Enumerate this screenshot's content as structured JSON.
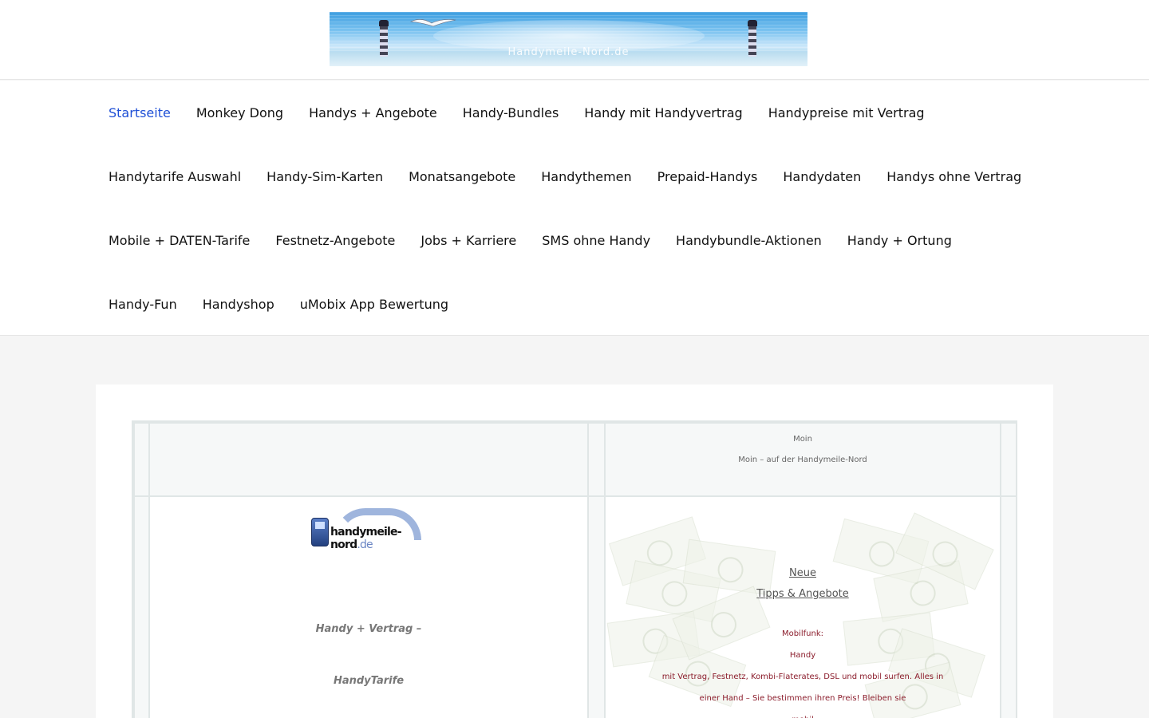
{
  "banner": {
    "text": "Handymeile-Nord.de"
  },
  "nav": {
    "rows": [
      [
        "Startseite",
        "Monkey Dong",
        "Handys + Angebote",
        "Handy-Bundles",
        "Handy mit Handyvertrag",
        "Handypreise mit Vertrag"
      ],
      [
        "Handytarife Auswahl",
        "Handy-Sim-Karten",
        "Monatsangebote",
        "Handythemen",
        "Prepaid-Handys",
        "Handydaten",
        "Handys ohne Vertrag"
      ],
      [
        "Mobile + DATEN-Tarife",
        "Festnetz-Angebote",
        "Jobs + Karriere",
        "SMS ohne Handy",
        "Handybundle-Aktionen",
        "Handy + Ortung"
      ],
      [
        "Handy-Fun",
        "Handyshop",
        "uMobix App Bewertung"
      ]
    ],
    "active": "Startseite",
    "active_color": "#1e4fd6"
  },
  "table": {
    "greeting_short": "Moin",
    "greeting_long": "Moin – auf der Handymeile-Nord",
    "logo_name": "handymeile-nord",
    "logo_tld": ".de",
    "tagline_1": "Handy + Vertrag –",
    "tagline_2": "HandyTarife",
    "link_1": "Neue",
    "link_2": "Tipps & Angebote",
    "red_1": "Mobilfunk:",
    "red_2": "Handy",
    "red_3": "mit Vertrag, Festnetz, Kombi-Flaterates, DSL und mobil surfen. Alles in",
    "red_4": "einer Hand –  Sie bestimmen ihren Preis! Bleiben sie",
    "red_5": "mobil"
  }
}
